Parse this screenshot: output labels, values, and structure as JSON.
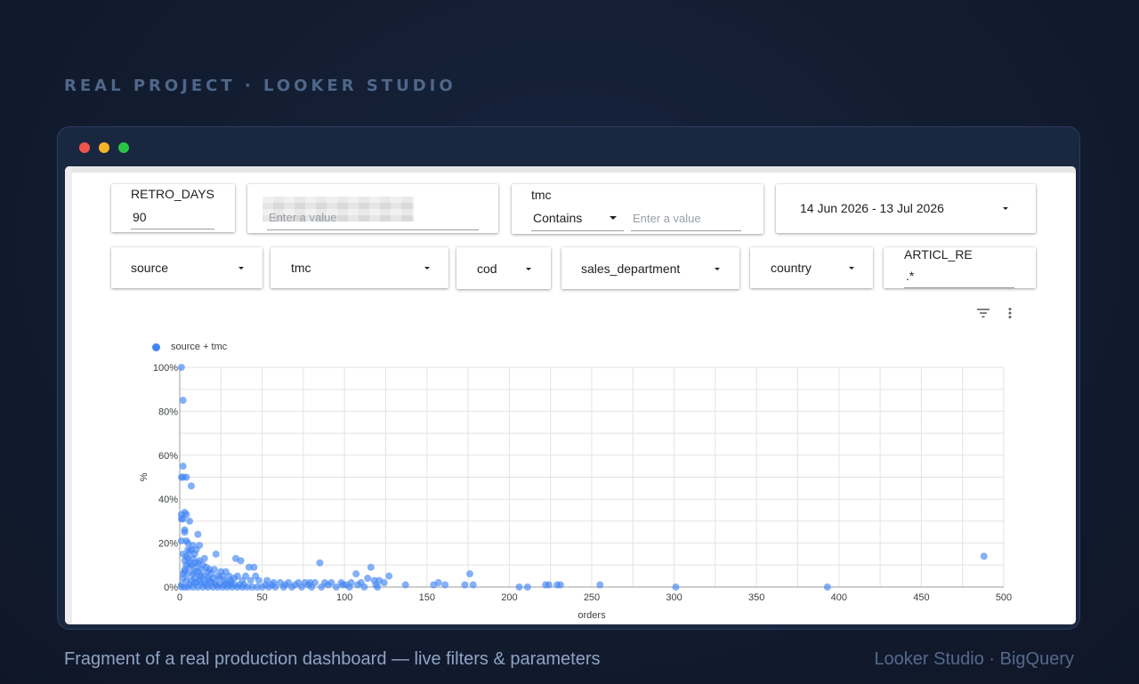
{
  "eyebrow": "REAL PROJECT · LOOKER STUDIO",
  "footer": {
    "caption": "Fragment of a real production dashboard — live filters & parameters",
    "stack": "Looker Studio · BigQuery"
  },
  "filters": {
    "retro": {
      "label": "RETRO_DAYS",
      "value": "90"
    },
    "redacted": {
      "placeholder": "Enter a value"
    },
    "tmc_text": {
      "label": "tmc",
      "operator": "Contains",
      "placeholder": "Enter a value"
    },
    "date_range": {
      "value": "14 Jun 2026 - 13 Jul 2026"
    },
    "dropdowns": [
      "source",
      "tmc",
      "cod",
      "sales_department",
      "country"
    ],
    "articl": {
      "label": "ARTICL_RE",
      "value": ".*"
    }
  },
  "chart_data": {
    "type": "scatter",
    "legend": "source + tmc",
    "xlabel": "orders",
    "ylabel": "%",
    "xlim": [
      0,
      500
    ],
    "ylim": [
      0,
      100
    ],
    "x_ticks": [
      "0",
      "50",
      "100",
      "150",
      "200",
      "250",
      "300",
      "350",
      "400",
      "450",
      "500"
    ],
    "y_ticks": [
      "0%",
      "20%",
      "40%",
      "60%",
      "80%",
      "100%"
    ],
    "color": "#4285f4",
    "points": [
      [
        1,
        100
      ],
      [
        2,
        85
      ],
      [
        2,
        55
      ],
      [
        1,
        50
      ],
      [
        2,
        50
      ],
      [
        4,
        50
      ],
      [
        7,
        46
      ],
      [
        3,
        34
      ],
      [
        1,
        33
      ],
      [
        4,
        33
      ],
      [
        1,
        31
      ],
      [
        2,
        31
      ],
      [
        3,
        26
      ],
      [
        3,
        25
      ],
      [
        6,
        30
      ],
      [
        11,
        24
      ],
      [
        4,
        21
      ],
      [
        8,
        19
      ],
      [
        12,
        19
      ],
      [
        5,
        17
      ],
      [
        7,
        17
      ],
      [
        2,
        15
      ],
      [
        10,
        17
      ],
      [
        6,
        16
      ],
      [
        9,
        15
      ],
      [
        4,
        14
      ],
      [
        5,
        13
      ],
      [
        8,
        13
      ],
      [
        12,
        12
      ],
      [
        3,
        12
      ],
      [
        11,
        11
      ],
      [
        15,
        13
      ],
      [
        9,
        11
      ],
      [
        7,
        10
      ],
      [
        4,
        10
      ],
      [
        14,
        10
      ],
      [
        22,
        15
      ],
      [
        16,
        9
      ],
      [
        6,
        9
      ],
      [
        10,
        9
      ],
      [
        3,
        8
      ],
      [
        13,
        8
      ],
      [
        18,
        8
      ],
      [
        21,
        8
      ],
      [
        25,
        7
      ],
      [
        28,
        7
      ],
      [
        42,
        9
      ],
      [
        45,
        9
      ],
      [
        34,
        13
      ],
      [
        37,
        12
      ],
      [
        11,
        7
      ],
      [
        19,
        6
      ],
      [
        5,
        6
      ],
      [
        8,
        6
      ],
      [
        26,
        5
      ],
      [
        30,
        5
      ],
      [
        40,
        5
      ],
      [
        15,
        5
      ],
      [
        12,
        5
      ],
      [
        46,
        5
      ],
      [
        35,
        5
      ],
      [
        2,
        4
      ],
      [
        9,
        4
      ],
      [
        17,
        4
      ],
      [
        24,
        4
      ],
      [
        33,
        4
      ],
      [
        38,
        3
      ],
      [
        43,
        3
      ],
      [
        48,
        3
      ],
      [
        53,
        3
      ],
      [
        57,
        2
      ],
      [
        61,
        2
      ],
      [
        66,
        2
      ],
      [
        72,
        2
      ],
      [
        76,
        2
      ],
      [
        79,
        2
      ],
      [
        85,
        11
      ],
      [
        82,
        2
      ],
      [
        88,
        2
      ],
      [
        92,
        2
      ],
      [
        98,
        2
      ],
      [
        101,
        1
      ],
      [
        104,
        2
      ],
      [
        107,
        6
      ],
      [
        110,
        2
      ],
      [
        114,
        4
      ],
      [
        116,
        9
      ],
      [
        118,
        3
      ],
      [
        121,
        3
      ],
      [
        124,
        2
      ],
      [
        127,
        5
      ],
      [
        137,
        1
      ],
      [
        154,
        1
      ],
      [
        157,
        2
      ],
      [
        161,
        1
      ],
      [
        173,
        1
      ],
      [
        176,
        6
      ],
      [
        178,
        1
      ],
      [
        206,
        0
      ],
      [
        211,
        0
      ],
      [
        222,
        1
      ],
      [
        224,
        1
      ],
      [
        229,
        1
      ],
      [
        231,
        1
      ],
      [
        255,
        1
      ],
      [
        301,
        0
      ],
      [
        393,
        0
      ],
      [
        488,
        14
      ],
      [
        1,
        0
      ],
      [
        3,
        0
      ],
      [
        5,
        0
      ],
      [
        8,
        0
      ],
      [
        11,
        0
      ],
      [
        14,
        0
      ],
      [
        17,
        0
      ],
      [
        20,
        0
      ],
      [
        23,
        0
      ],
      [
        26,
        0
      ],
      [
        29,
        0
      ],
      [
        32,
        0
      ],
      [
        35,
        0
      ],
      [
        38,
        0
      ],
      [
        41,
        0
      ],
      [
        44,
        0
      ],
      [
        47,
        0
      ],
      [
        50,
        0
      ],
      [
        54,
        0
      ],
      [
        58,
        0
      ],
      [
        63,
        0
      ],
      [
        68,
        0
      ],
      [
        74,
        0
      ],
      [
        80,
        0
      ],
      [
        86,
        0
      ],
      [
        95,
        0
      ],
      [
        103,
        0
      ],
      [
        112,
        0
      ],
      [
        120,
        0
      ],
      [
        1,
        1
      ],
      [
        6,
        1
      ],
      [
        10,
        2
      ],
      [
        13,
        2
      ],
      [
        16,
        1
      ],
      [
        19,
        2
      ],
      [
        22,
        1
      ],
      [
        27,
        1
      ],
      [
        31,
        2
      ],
      [
        36,
        1
      ],
      [
        39,
        1
      ],
      [
        52,
        1
      ],
      [
        56,
        1
      ],
      [
        64,
        1
      ],
      [
        70,
        1
      ],
      [
        78,
        1
      ],
      [
        90,
        1
      ],
      [
        99,
        1
      ],
      [
        108,
        1
      ],
      [
        119,
        1
      ],
      [
        2,
        6
      ],
      [
        4,
        3
      ],
      [
        7,
        3
      ],
      [
        9,
        2
      ],
      [
        12,
        3
      ],
      [
        15,
        2
      ],
      [
        18,
        3
      ],
      [
        21,
        2
      ],
      [
        24,
        1
      ],
      [
        28,
        2
      ],
      [
        30,
        1
      ],
      [
        33,
        1
      ],
      [
        9,
        7
      ],
      [
        13,
        5
      ],
      [
        17,
        7
      ],
      [
        20,
        4
      ],
      [
        23,
        5
      ],
      [
        27,
        3
      ],
      [
        31,
        3
      ],
      [
        6,
        11
      ],
      [
        3,
        7
      ],
      [
        1,
        21
      ],
      [
        5,
        20
      ]
    ]
  }
}
